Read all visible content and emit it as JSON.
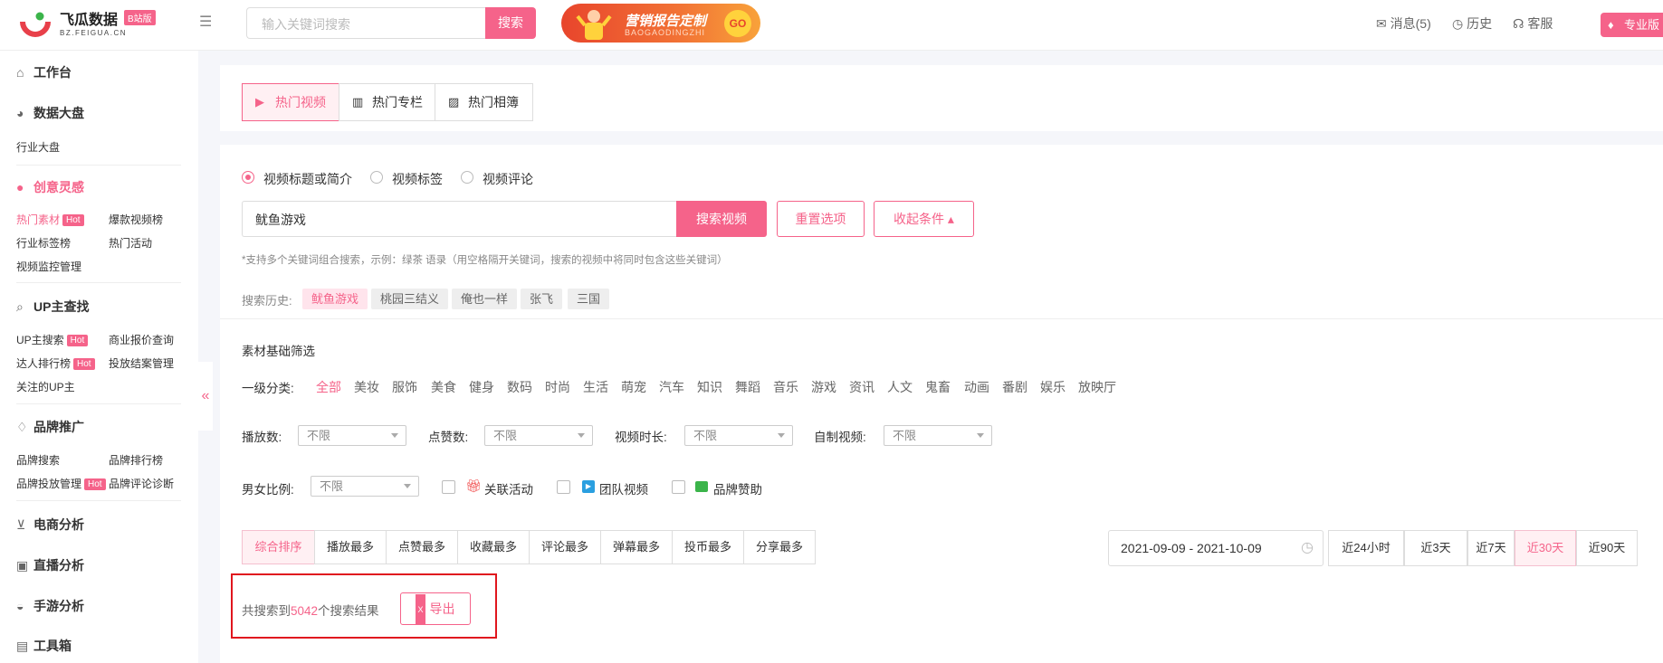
{
  "brand": {
    "name": "飞瓜数据",
    "badge": "B站版",
    "domain": "BZ.FEIGUA.CN"
  },
  "search": {
    "placeholder": "输入关键词搜索",
    "button": "搜索"
  },
  "banner": {
    "title": "营销报告定制",
    "subtitle": "BAOGAODINGZHI",
    "go": "GO"
  },
  "top_links": {
    "messages": "消息(5)",
    "history": "历史",
    "service": "客服",
    "pro": "专业版"
  },
  "sidebar": {
    "workbench": "工作台",
    "data_screen": {
      "title": "数据大盘",
      "items": [
        "行业大盘"
      ]
    },
    "creative": {
      "title": "创意灵感",
      "items": [
        "热门素材",
        "爆款视频榜",
        "行业标签榜",
        "热门活动",
        "视频监控管理"
      ]
    },
    "up": {
      "title": "UP主查找",
      "items": [
        "UP主搜索",
        "商业报价查询",
        "达人排行榜",
        "投放结案管理",
        "关注的UP主"
      ]
    },
    "brand": {
      "title": "品牌推广",
      "items": [
        "品牌搜索",
        "品牌排行榜",
        "品牌投放管理",
        "品牌评论诊断"
      ]
    },
    "ecommerce": "电商分析",
    "live": "直播分析",
    "mobile_game": "手游分析",
    "tools": "工具箱",
    "hot_badge": "Hot",
    "collapse": "«"
  },
  "tabs": [
    "热门视频",
    "热门专栏",
    "热门相簿"
  ],
  "search_scope": [
    "视频标题或简介",
    "视频标签",
    "视频评论"
  ],
  "keyword": {
    "value": "鱿鱼游戏",
    "search_btn": "搜索视频",
    "reset_btn": "重置选项",
    "collapse_btn": "收起条件 ▴"
  },
  "hint": "*支持多个关键词组合搜索，示例：绿茶 语录（用空格隔开关键词，搜索的视频中将同时包含这些关键词）",
  "history": {
    "label": "搜索历史:",
    "items": [
      "鱿鱼游戏",
      "桃园三结义",
      "俺也一样",
      "张飞",
      "三国"
    ]
  },
  "filters": {
    "section_title": "素材基础筛选",
    "category_label": "一级分类:",
    "categories": [
      "全部",
      "美妆",
      "服饰",
      "美食",
      "健身",
      "数码",
      "时尚",
      "生活",
      "萌宠",
      "汽车",
      "知识",
      "舞蹈",
      "音乐",
      "游戏",
      "资讯",
      "人文",
      "鬼畜",
      "动画",
      "番剧",
      "娱乐",
      "放映厅"
    ],
    "play_label": "播放数:",
    "like_label": "点赞数:",
    "duration_label": "视频时长:",
    "self_made_label": "自制视频:",
    "gender_label": "男女比例:",
    "any": "不限",
    "checks": [
      "关联活动",
      "团队视频",
      "品牌赞助"
    ]
  },
  "sorts": [
    "综合排序",
    "播放最多",
    "点赞最多",
    "收藏最多",
    "评论最多",
    "弹幕最多",
    "投币最多",
    "分享最多"
  ],
  "date_range": "2021-09-09 - 2021-10-09",
  "ranges": [
    "近24小时",
    "近3天",
    "近7天",
    "近30天",
    "近90天"
  ],
  "result": {
    "prefix": "共搜索到",
    "count": "5042",
    "suffix": "个搜索结果",
    "export": "导出"
  },
  "colors": {
    "accent": "#f5638a",
    "highlight_box": "#e0161e"
  }
}
